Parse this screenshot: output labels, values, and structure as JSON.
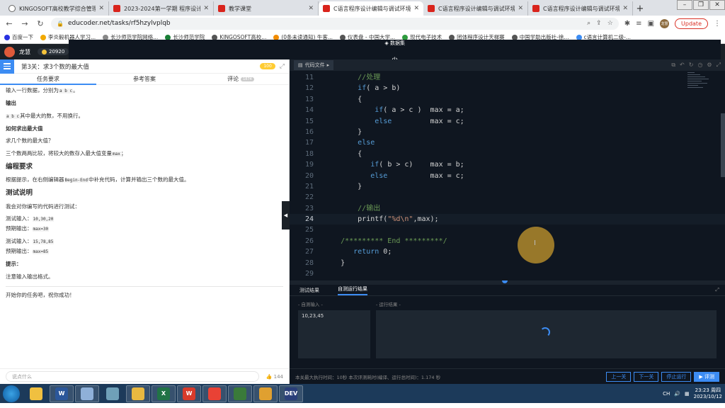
{
  "browser": {
    "tabs": [
      {
        "title": "KINGOSOFT高校教学综合管理",
        "icon": "globe",
        "active": false
      },
      {
        "title": "2023-2024第一学期 程序设计",
        "icon": "edu",
        "active": false
      },
      {
        "title": "教学课堂",
        "icon": "edu",
        "active": false
      },
      {
        "title": "C语言程序设计编辑与调试环境",
        "icon": "edu",
        "active": true
      },
      {
        "title": "C语言程序设计编辑与调试环境",
        "icon": "edu",
        "active": false
      },
      {
        "title": "C语言程序设计编辑与调试环境",
        "icon": "edu",
        "active": false
      }
    ],
    "url": "educoder.net/tasks/rf5hzylvplqb",
    "update_label": "Update",
    "profile_initials": "龙慧",
    "bookmarks": [
      {
        "label": "百度一下",
        "color": "#2932e1"
      },
      {
        "label": "李炎毅机器人学习...",
        "color": "#f2a900"
      },
      {
        "label": "长沙师范学院网络...",
        "color": "#888888"
      },
      {
        "label": "长沙师范学院",
        "color": "#1a7f37"
      },
      {
        "label": "KINGOSOFT高校...",
        "color": "#555555"
      },
      {
        "label": "(0条未读通知) 牛客...",
        "color": "#f28c00"
      },
      {
        "label": "仪表盘 - 中国大学...",
        "color": "#555555"
      },
      {
        "label": "现代电子技术",
        "color": "#2e9b3e"
      },
      {
        "label": "团体程序设计天梯赛",
        "color": "#555555"
      },
      {
        "label": "中国学助出版社-徐...",
        "color": "#555555"
      },
      {
        "label": "c语言计算机二级-...",
        "color": "#3c8cf3"
      }
    ]
  },
  "app": {
    "user_name": "龙慧",
    "coins": "20920",
    "title": "C语言程序设计编辑与调试环境",
    "subtitle": "实验总用时：00:08:00",
    "right_label": "数据集"
  },
  "task": {
    "level_title": "第3关：求3个数的最大值",
    "points": "100",
    "tabs": [
      {
        "label": "任务要求",
        "count": ""
      },
      {
        "label": "参考答案",
        "count": ""
      },
      {
        "label": "评论",
        "count": "1874"
      }
    ],
    "content": {
      "input_line_pre": "输入一行数据，分别为",
      "input_vars": "a b c",
      "input_line_post": "。",
      "output_heading": "输出",
      "output_vars": "a b c",
      "output_text": "其中最大的数，不用换行。",
      "how_heading": "如何求出最大值",
      "q_text": "求几个数的最大值？",
      "method_pre": "三个数两两比较，将较大的数存入最大值变量",
      "method_var": "max",
      "method_post": "；",
      "prog_heading": "编程要求",
      "prog_pre": "根据提示，在右侧编辑器",
      "prog_code": "Begin-End",
      "prog_post": "中补充代码，计算并输出三个数的最大值。",
      "test_heading": "测试说明",
      "test_intro": "我会对你编写的代码进行测试：",
      "test1_in_label": "测试输入：",
      "test1_in": "10,30,20",
      "test1_out_label": "预期输出：",
      "test1_out": "max=30",
      "test2_in_label": "测试输入：",
      "test2_in": "15,78,85",
      "test2_out_label": "预期输出：",
      "test2_out": "max=85",
      "tip_heading": "提示：",
      "tip_text": "注意输入输出格式。",
      "closing": "开始你的任务吧，祝你成功！"
    },
    "comment_placeholder": "说点什么",
    "likes": "144"
  },
  "editor": {
    "file_tab": "代码文件",
    "lines": [
      {
        "n": "11",
        "code": "        //处理"
      },
      {
        "n": "12",
        "code": "        if( a > b)"
      },
      {
        "n": "13",
        "code": "        {"
      },
      {
        "n": "14",
        "code": "            if( a > c )  max = a;"
      },
      {
        "n": "15",
        "code": "            else         max = c;"
      },
      {
        "n": "16",
        "code": "        }"
      },
      {
        "n": "17",
        "code": "        else"
      },
      {
        "n": "18",
        "code": "        {"
      },
      {
        "n": "19",
        "code": "           if( b > c)    max = b;"
      },
      {
        "n": "20",
        "code": "           else          max = c;"
      },
      {
        "n": "21",
        "code": "        }"
      },
      {
        "n": "22",
        "code": ""
      },
      {
        "n": "23",
        "code": "        //输出"
      },
      {
        "n": "24",
        "code": "        printf(\"%d\\n\",max);"
      },
      {
        "n": "25",
        "code": ""
      },
      {
        "n": "26",
        "code": "    /********* End *********/"
      },
      {
        "n": "27",
        "code": "       return 0;"
      },
      {
        "n": "28",
        "code": "    }"
      },
      {
        "n": "29",
        "code": ""
      }
    ],
    "current_line": "24"
  },
  "results": {
    "tabs": [
      "测试结果",
      "自测运行结果"
    ],
    "input_label": "- 自测输入 -",
    "input_value": "10,23,45",
    "output_label": "- 运行结果 -",
    "footer_text": "本关最大执行时间：10秒    本次评测耗时(编译、运行总时间)：1.174 秒",
    "buttons": {
      "prev": "上一关",
      "next": "下一关",
      "stop": "停止运行",
      "eval": "评测"
    }
  },
  "taskbar": {
    "time": "23:23 周四",
    "date": "2023/10/12",
    "lang": "CH",
    "apps": [
      {
        "name": "explorer-icon",
        "label": "",
        "color": "#f0c040",
        "open": false
      },
      {
        "name": "word-icon",
        "label": "W",
        "color": "#2b579a",
        "open": true
      },
      {
        "name": "notepad-icon",
        "label": "",
        "color": "#8fb0d8",
        "open": true
      },
      {
        "name": "pen-icon",
        "label": "",
        "color": "#6fa0b8",
        "open": false
      },
      {
        "name": "folder-icon",
        "label": "",
        "color": "#e8b840",
        "open": true
      },
      {
        "name": "excel-icon",
        "label": "X",
        "color": "#217346",
        "open": true
      },
      {
        "name": "wps-icon",
        "label": "W",
        "color": "#d83b2b",
        "open": true
      },
      {
        "name": "chrome-icon",
        "label": "",
        "color": "#e94235",
        "open": true
      },
      {
        "name": "project-icon",
        "label": "",
        "color": "#3a7a3a",
        "open": true
      },
      {
        "name": "bubble-icon",
        "label": "",
        "color": "#e0a030",
        "open": true
      },
      {
        "name": "devcpp-icon",
        "label": "DEV",
        "color": "#2a3f7a",
        "open": true
      }
    ]
  }
}
